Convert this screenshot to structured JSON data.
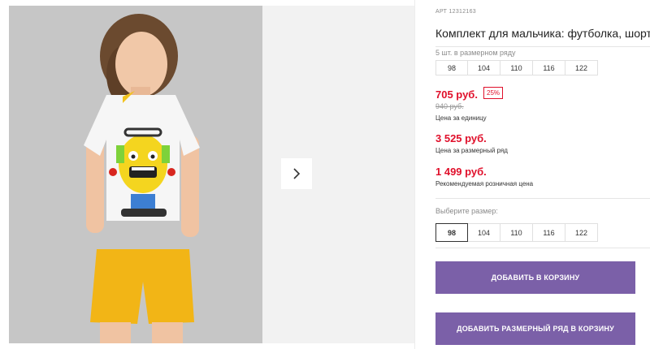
{
  "product": {
    "sku": "АРТ 12312163",
    "title": "Комплект для мальчика: футболка, шорты"
  },
  "size_row": {
    "label": "5 шт. в размерном ряду",
    "sizes": [
      "98",
      "104",
      "110",
      "116",
      "122"
    ]
  },
  "prices": {
    "unit_price": "705 руб.",
    "discount": "25%",
    "old_price": "940 руб.",
    "unit_label": "Цена за единицу",
    "row_price": "3 525 руб.",
    "row_label": "Цена за размерный ряд",
    "retail_price": "1 499 руб.",
    "retail_label": "Рекомендуемая розничная цена"
  },
  "size_select": {
    "label": "Выберите размер:",
    "sizes": [
      "98",
      "104",
      "110",
      "116",
      "122"
    ],
    "selected": "98"
  },
  "buttons": {
    "add_to_cart": "ДОБАВИТЬ В КОРЗИНУ",
    "add_row_to_cart": "ДОБАВИТЬ РАЗМЕРНЫЙ РЯД В КОРЗИНУ"
  },
  "colors": {
    "accent": "#7b60a8",
    "price": "#e0102b"
  }
}
